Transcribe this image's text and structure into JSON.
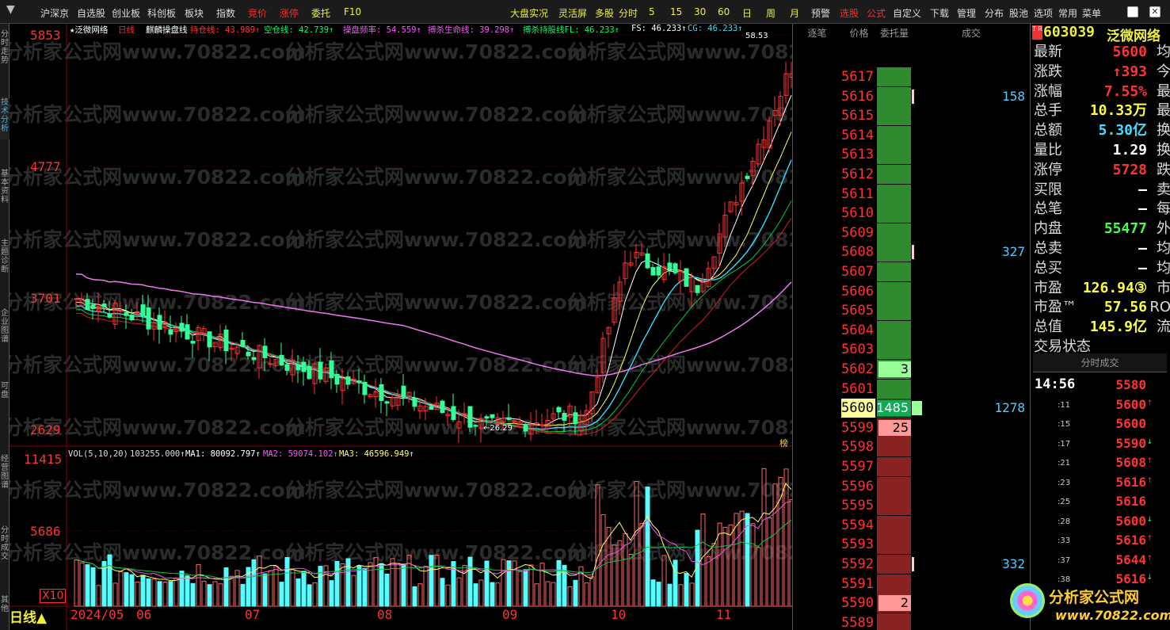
{
  "menu": {
    "left": [
      "沪深京",
      "自选股",
      "创业板",
      "科创板",
      "板块",
      "指数",
      "竞价",
      "涨停",
      "委托",
      "F10"
    ],
    "right": [
      "大盘实况",
      "灵活屏",
      "多股",
      "分时",
      "5",
      "15",
      "30",
      "60",
      "日",
      "周",
      "月",
      "预警",
      "选股",
      "公式",
      "自定义",
      "下载",
      "管理",
      "分布",
      "股池",
      "选项",
      "常用",
      "菜单"
    ]
  },
  "sidebar_tabs": [
    "分时走势",
    "技术分析",
    "基本资料",
    "主题诊断",
    "企业图谱",
    "可盘",
    "经营图谱",
    "分时成交",
    "其他"
  ],
  "chart": {
    "title": "泛微网络",
    "period": "日线",
    "formula": "麒麟操盘线",
    "indicators": [
      {
        "label": "持仓线: 43.989↑",
        "color": "#ff3333"
      },
      {
        "label": "空仓线: 42.739↑",
        "color": "#00ff66"
      },
      {
        "label": "操盘频率: 54.559↑",
        "color": "#ff55ff"
      },
      {
        "label": "搏杀生命线: 39.298↑",
        "color": "#ff55ff"
      },
      {
        "label": "搏杀持股线FL: 46.233↑",
        "color": "#00ff66"
      },
      {
        "label": "FS: 46.233↑",
        "color": "#ffffff"
      },
      {
        "label": "CG: 46.233↑",
        "color": "#33ddff"
      }
    ],
    "price_labels": [
      "5853",
      "4777",
      "3701",
      "2629"
    ],
    "high_label": "58.53",
    "low_label": "26.29",
    "rank_label": "榜",
    "vol_labels": [
      "11415",
      "5686"
    ],
    "vol_unit": "X10",
    "vol_indicator": "VOL(5,10,20)",
    "vol_value": "103255.000↑",
    "vol_ma": [
      {
        "label": "MA1: 80092.797↑",
        "color": "#ffffff"
      },
      {
        "label": "MA2: 59074.102↑",
        "color": "#ff55ff"
      },
      {
        "label": "MA3: 46596.949↑",
        "color": "#ffff66"
      }
    ],
    "date_labels": [
      "2024/05",
      "06",
      "07",
      "08",
      "09",
      "10",
      "11"
    ],
    "period_button": "日线▲",
    "watermark": "分析家公式网www.70822.com"
  },
  "book": {
    "headers": [
      "逐笔",
      "价格",
      "委托量",
      "成交"
    ],
    "rows": [
      {
        "price": "5617",
        "qty": "",
        "ord": "",
        "trade": ""
      },
      {
        "price": "5616",
        "qty": "",
        "ord": "",
        "trade": "158"
      },
      {
        "price": "5615",
        "qty": "",
        "ord": "",
        "trade": ""
      },
      {
        "price": "5614",
        "qty": "",
        "ord": "",
        "trade": ""
      },
      {
        "price": "5613",
        "qty": "",
        "ord": "",
        "trade": ""
      },
      {
        "price": "5612",
        "qty": "",
        "ord": "",
        "trade": ""
      },
      {
        "price": "5611",
        "qty": "",
        "ord": "",
        "trade": ""
      },
      {
        "price": "5610",
        "qty": "",
        "ord": "",
        "trade": ""
      },
      {
        "price": "5609",
        "qty": "",
        "ord": "",
        "trade": ""
      },
      {
        "price": "5608",
        "qty": "",
        "ord": "",
        "trade": "327"
      },
      {
        "price": "5607",
        "qty": "",
        "ord": "",
        "trade": ""
      },
      {
        "price": "5606",
        "qty": "",
        "ord": "",
        "trade": ""
      },
      {
        "price": "5605",
        "qty": "",
        "ord": "",
        "trade": ""
      },
      {
        "price": "5604",
        "qty": "",
        "ord": "",
        "trade": ""
      },
      {
        "price": "5603",
        "qty": "",
        "ord": "",
        "trade": ""
      },
      {
        "price": "5602",
        "qty": "3",
        "ord": "②",
        "trade": ""
      },
      {
        "price": "5601",
        "qty": "",
        "ord": "",
        "trade": ""
      },
      {
        "price": "5600",
        "qty": "1485",
        "ord": "",
        "trade": "1278"
      },
      {
        "price": "5599",
        "qty": "25",
        "ord": "①",
        "trade": ""
      },
      {
        "price": "5598",
        "qty": "",
        "ord": "",
        "trade": ""
      },
      {
        "price": "5597",
        "qty": "",
        "ord": "",
        "trade": ""
      },
      {
        "price": "5596",
        "qty": "",
        "ord": "",
        "trade": ""
      },
      {
        "price": "5595",
        "qty": "",
        "ord": "",
        "trade": ""
      },
      {
        "price": "5594",
        "qty": "",
        "ord": "",
        "trade": ""
      },
      {
        "price": "5593",
        "qty": "",
        "ord": "",
        "trade": ""
      },
      {
        "price": "5592",
        "qty": "",
        "ord": "",
        "trade": "332"
      },
      {
        "price": "5591",
        "qty": "",
        "ord": "",
        "trade": ""
      },
      {
        "price": "5590",
        "qty": "2",
        "ord": "②",
        "trade": ""
      },
      {
        "price": "5589",
        "qty": "",
        "ord": "",
        "trade": ""
      },
      {
        "price": "5588",
        "qty": "",
        "ord": "",
        "trade": ""
      }
    ]
  },
  "quote": {
    "badge": "T R",
    "code": "603039",
    "name": "泛微网络",
    "rows": [
      {
        "label": "最新",
        "value": "5600",
        "color": "#ff3333",
        "extra": "均"
      },
      {
        "label": "涨跌",
        "value": "↑393",
        "color": "#ff3333",
        "extra": "今"
      },
      {
        "label": "涨幅",
        "value": "7.55%",
        "color": "#ff3333",
        "extra": "最"
      },
      {
        "label": "总手",
        "value": "10.33万",
        "color": "#ffff44",
        "extra": "最"
      },
      {
        "label": "总额",
        "value": "5.30亿",
        "color": "#44ddff",
        "extra": "换"
      },
      {
        "label": "量比",
        "value": "1.29",
        "color": "#ffffff",
        "extra": "换"
      },
      {
        "label": "涨停",
        "value": "5728",
        "color": "#ff3333",
        "extra": "跌"
      },
      {
        "label": "买限",
        "value": "–",
        "color": "#ffffff",
        "extra": "卖"
      },
      {
        "label": "总笔",
        "value": "–",
        "color": "#ffffff",
        "extra": "每"
      },
      {
        "label": "内盘",
        "value": "55477",
        "color": "#44ff44",
        "extra": "外"
      },
      {
        "label": "总卖",
        "value": "–",
        "color": "#ffffff",
        "extra": "均"
      },
      {
        "label": "总买",
        "value": "–",
        "color": "#ffffff",
        "extra": "均"
      },
      {
        "label": "市盈",
        "value": "126.94③",
        "color": "#ffff44",
        "extra": "市"
      },
      {
        "label": "市盈™",
        "value": "57.56",
        "color": "#ffff44",
        "extra": "RO"
      },
      {
        "label": "总值",
        "value": "145.9亿",
        "color": "#ffff44",
        "extra": "流"
      },
      {
        "label": "交易状态",
        "value": "",
        "color": "#ffffff",
        "extra": ""
      }
    ],
    "ticks_title": "分时成交",
    "ticks": [
      {
        "time": "14:56",
        "price": "5580",
        "arrow": ""
      },
      {
        "time": ":11",
        "price": "5600",
        "arrow": "↑"
      },
      {
        "time": ":15",
        "price": "5600",
        "arrow": ""
      },
      {
        "time": ":17",
        "price": "5590",
        "arrow": "↓"
      },
      {
        "time": ":21",
        "price": "5608",
        "arrow": "↑"
      },
      {
        "time": ":23",
        "price": "5616",
        "arrow": "↑"
      },
      {
        "time": ":25",
        "price": "5616",
        "arrow": ""
      },
      {
        "time": ":28",
        "price": "5600",
        "arrow": "↓"
      },
      {
        "time": ":33",
        "price": "5616",
        "arrow": "↑"
      },
      {
        "time": ":37",
        "price": "5644",
        "arrow": "↑"
      },
      {
        "time": ":38",
        "price": "5616",
        "arrow": "↓"
      }
    ],
    "logo_text": "分析家公式网",
    "logo_url": "www.70822.com"
  },
  "colors": {
    "up": "#ff3333",
    "down": "#33ff99",
    "vol_up": "#ff6666",
    "vol_down": "#55ffff",
    "ask_bg": "#2e8b2e",
    "bid_bg": "#8b2222"
  }
}
